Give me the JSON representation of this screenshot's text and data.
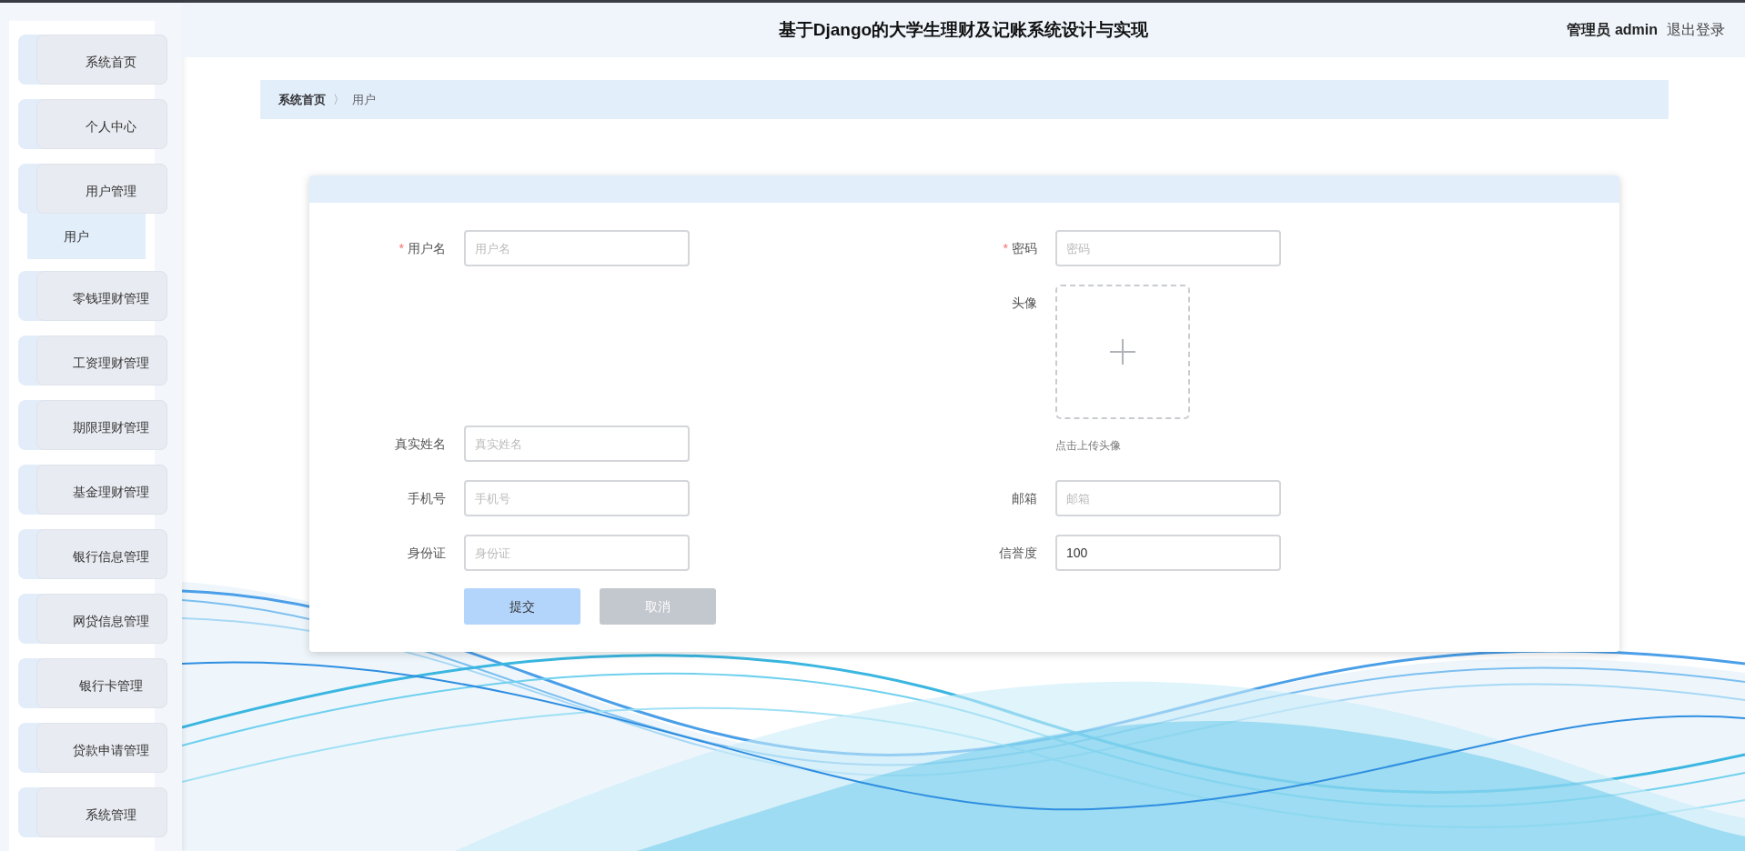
{
  "header": {
    "title": "基于Django的大学生理财及记账系统设计与实现",
    "user": "管理员 admin",
    "logout": "退出登录"
  },
  "sidebar": {
    "items": [
      {
        "label": "系统首页"
      },
      {
        "label": "个人中心"
      },
      {
        "label": "用户管理",
        "children": [
          {
            "label": "用户",
            "selected": true
          }
        ]
      },
      {
        "label": "零钱理财管理"
      },
      {
        "label": "工资理财管理"
      },
      {
        "label": "期限理财管理"
      },
      {
        "label": "基金理财管理"
      },
      {
        "label": "银行信息管理"
      },
      {
        "label": "网贷信息管理"
      },
      {
        "label": "银行卡管理"
      },
      {
        "label": "贷款申请管理"
      },
      {
        "label": "系统管理"
      }
    ]
  },
  "breadcrumb": {
    "items": [
      "系统首页",
      "用户"
    ],
    "separator": "〉"
  },
  "form": {
    "columns": [
      {
        "fields": [
          {
            "kind": "text",
            "label": "用户名",
            "marker": "*",
            "placeholder": "用户名"
          },
          {
            "kind": "text",
            "label": "真实姓名",
            "placeholder": "真实姓名"
          },
          {
            "kind": "text",
            "label": "手机号",
            "placeholder": "手机号"
          },
          {
            "kind": "text",
            "label": "身份证",
            "placeholder": "身份证"
          }
        ]
      },
      {
        "fields": [
          {
            "kind": "text",
            "label": "密码",
            "marker": "*",
            "placeholder": "密码"
          },
          {
            "kind": "upload",
            "label": "头像",
            "hint": "点击上传头像"
          },
          {
            "kind": "text",
            "label": "邮箱",
            "placeholder": "邮箱"
          },
          {
            "kind": "text",
            "label": "信誉度",
            "value": "100"
          }
        ]
      }
    ],
    "buttons": [
      {
        "label": "提交",
        "kind": "primary"
      },
      {
        "label": "取消",
        "kind": "secondary"
      }
    ]
  }
}
